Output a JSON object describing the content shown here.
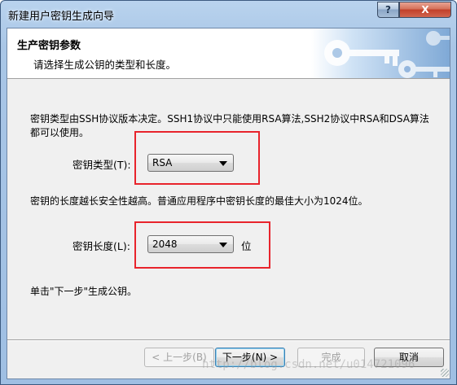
{
  "window": {
    "title": "新建用户密钥生成向导",
    "help_label": "?",
    "close_label": "X"
  },
  "header": {
    "title": "生产密钥参数",
    "subtitle": "请选择生成公钥的类型和长度。"
  },
  "body": {
    "description_type": "密钥类型由SSH协议版本决定。SSH1协议中只能使用RSA算法,SSH2协议中RSA和DSA算法都可以使用。",
    "description_length": "密钥的长度越长安全性越高。普通应用程序中密钥长度的最佳大小为1024位。",
    "hint": "单击\"下一步\"生成公钥。"
  },
  "fields": {
    "key_type": {
      "label": "密钥类型(T):",
      "value": "RSA"
    },
    "key_length": {
      "label": "密钥长度(L):",
      "value": "2048",
      "unit": "位"
    }
  },
  "buttons": {
    "back": "< 上一步(B)",
    "next": "下一步(N) >",
    "finish": "完成",
    "cancel": "取消"
  },
  "watermark": "http://blog.csdn.net/u014721096",
  "colors": {
    "highlight_box": "#e8242c",
    "title_bar": "#a9c6e6",
    "close_button": "#c2402a"
  }
}
